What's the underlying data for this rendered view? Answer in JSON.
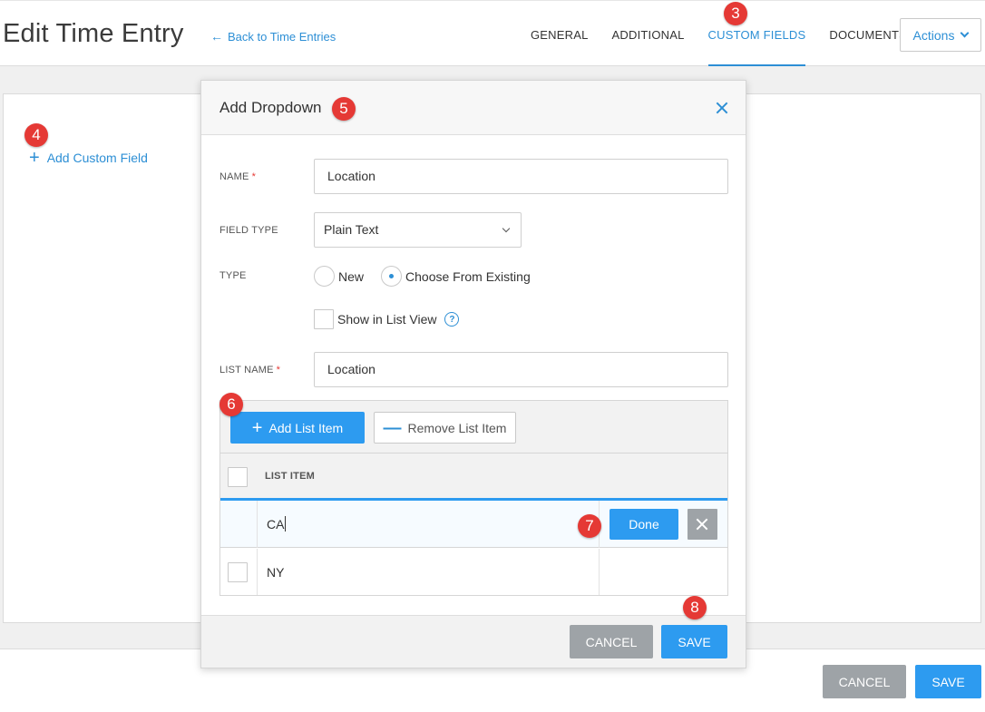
{
  "header": {
    "title": "Edit Time Entry",
    "back_link": "Back to Time Entries",
    "tabs": [
      {
        "label": "GENERAL"
      },
      {
        "label": "ADDITIONAL"
      },
      {
        "label": "CUSTOM FIELDS"
      },
      {
        "label": "DOCUMENTS"
      }
    ],
    "active_tab": "CUSTOM FIELDS",
    "actions_label": "Actions"
  },
  "content": {
    "add_custom_field": "Add Custom Field"
  },
  "footer": {
    "cancel_label": "CANCEL",
    "save_label": "SAVE"
  },
  "modal": {
    "title": "Add Dropdown",
    "name_label": "NAME",
    "name_value": "Location",
    "field_type_label": "FIELD TYPE",
    "field_type_value": "Plain Text",
    "type_label": "TYPE",
    "type_options": [
      "New",
      "Choose From Existing"
    ],
    "type_selected": "Choose From Existing",
    "show_in_list_view_label": "Show in List View",
    "show_in_list_view_checked": false,
    "list_name_label": "LIST NAME",
    "list_name_value": "Location",
    "add_list_item_label": "Add List Item",
    "remove_list_item_label": "Remove List Item",
    "list_column_header": "LIST ITEM",
    "editing_item_value": "CA",
    "done_label": "Done",
    "items": [
      {
        "value": "NY"
      }
    ],
    "cancel_label": "CANCEL",
    "save_label": "SAVE"
  },
  "required_marker": "*",
  "help_glyph": "?",
  "step_badges": [
    "3",
    "4",
    "5",
    "6",
    "7",
    "8"
  ],
  "colors": {
    "accent": "#2d8fd5",
    "primary_button": "#2d9bf0",
    "secondary_button": "#9ea3a7",
    "badge": "#e53935"
  },
  "icons": {
    "back": "arrow-left-icon",
    "actions_caret": "chevron-down-icon",
    "add": "plus-icon",
    "remove": "minus-icon",
    "close": "close-icon",
    "help": "question-icon"
  }
}
